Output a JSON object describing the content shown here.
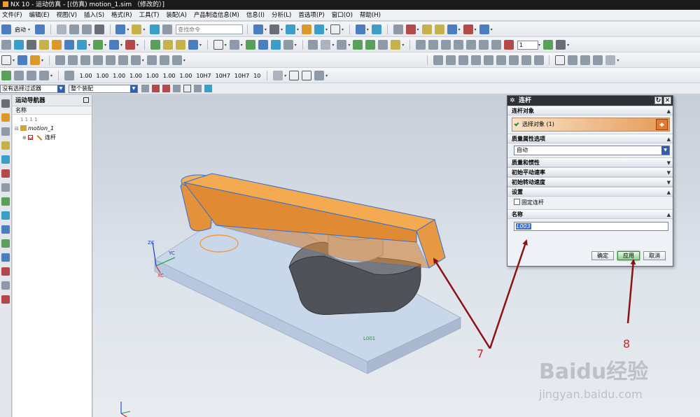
{
  "window": {
    "title": "NX 10 - 运动仿真 - [(仿真) motion_1.sim （修改的）]"
  },
  "menu": [
    "文件(F)",
    "编辑(E)",
    "视图(V)",
    "插入(S)",
    "格式(R)",
    "工具(T)",
    "装配(A)",
    "产品制造信息(M)",
    "信息(I)",
    "分析(L)",
    "首选项(P)",
    "窗口(O)",
    "帮助(H)"
  ],
  "toolbar": {
    "start_label": "启动",
    "command_search_placeholder": "查找命令",
    "frame_value": "1",
    "tolerance_buttons": [
      "1.00",
      "1.00",
      "1.00",
      "1.00",
      "1.00",
      "1.00",
      "1.00",
      "10H7",
      "10H7",
      "10H7",
      "10"
    ]
  },
  "filters": {
    "selection_filter": "没有选择过滤器",
    "assembly_scope": "整个装配"
  },
  "navigator": {
    "title": "运动导航器",
    "column_name": "名称",
    "tree": [
      {
        "label": "1 1 1 1",
        "level": 0
      },
      {
        "label": "motion_1",
        "level": 0
      },
      {
        "label": "连杆",
        "level": 1
      }
    ]
  },
  "viewport": {
    "triad_labels": [
      "ZC",
      "YC",
      "XC"
    ],
    "part_label": "L001"
  },
  "dialog": {
    "title": "连杆",
    "section_link_object": "连杆对象",
    "select_object_label": "选择对象 (1)",
    "section_mass_option": "质量属性选项",
    "mass_option_value": "自动",
    "section_mass_inertia": "质量和惯性",
    "section_init_trans_vel": "初始平动速率",
    "section_init_rot_vel": "初始转动速度",
    "section_settings": "设置",
    "fixed_link_label": "固定连杆",
    "section_name": "名称",
    "name_value": "L003",
    "ok_label": "确定",
    "apply_label": "应用",
    "cancel_label": "取消"
  },
  "annotations": {
    "callout_7": "7",
    "callout_8": "8"
  },
  "watermark": {
    "brand": "Baidu经验",
    "url": "jingyan.baidu.com"
  },
  "colors": {
    "highlight_orange": "#f0a040",
    "part_edge": "#2f6fd6",
    "base_plate": "#c9d7ea",
    "cam_dark": "#5a5d62",
    "annotation_red": "#c72a2a",
    "arrow_darkred": "#8b1212"
  }
}
